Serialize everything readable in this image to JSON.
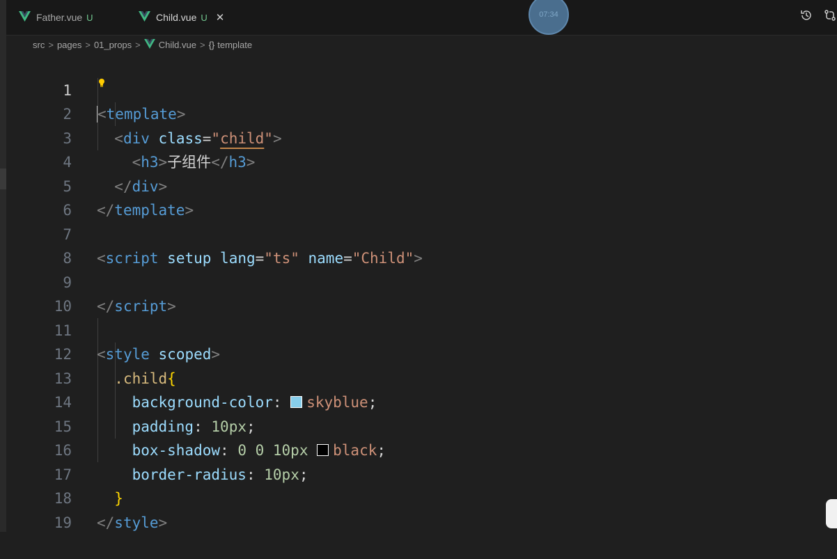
{
  "tabs": [
    {
      "name": "Father.vue",
      "status": "U"
    },
    {
      "name": "Child.vue",
      "status": "U",
      "close": "✕"
    }
  ],
  "overlay_time": "07:34",
  "breadcrumb": [
    "src",
    "pages",
    "01_props",
    "Child.vue",
    "template"
  ],
  "breadcrumb_sep": ">",
  "breadcrumb_braces": "{}",
  "icons": {
    "vue_logo": "vue-logo-icon",
    "history": "history-icon",
    "compare": "compare-changes-icon",
    "lightbulb": "lightbulb-icon"
  },
  "colors": {
    "vue_green": "#41b883",
    "skyblue": "#87ceeb",
    "black": "#000000"
  },
  "code": {
    "line_numbers": [
      "1",
      "2",
      "3",
      "4",
      "5",
      "6",
      "7",
      "8",
      "9",
      "10",
      "11",
      "12",
      "13",
      "14",
      "15",
      "16",
      "17",
      "18",
      "19"
    ],
    "l1": {
      "lt": "<",
      "tag": "template",
      "gt": ">"
    },
    "l2": {
      "lt": "<",
      "tag": "div",
      "attr": "class",
      "eq": "=",
      "q1": "\"",
      "val": "child",
      "q2": "\"",
      "gt": ">"
    },
    "l3": {
      "lt": "<",
      "tag": "h3",
      "gt": ">",
      "text": "子组件",
      "lt2": "</",
      "tag2": "h3",
      "gt2": ">"
    },
    "l4": {
      "lt": "</",
      "tag": "div",
      "gt": ">"
    },
    "l5": {
      "lt": "</",
      "tag": "template",
      "gt": ">"
    },
    "l7": {
      "lt": "<",
      "tag": "script",
      "attr1": "setup",
      "attr2": "lang",
      "eq": "=",
      "val2": "\"ts\"",
      "attr3": "name",
      "val3": "\"Child\"",
      "gt": ">"
    },
    "l9": {
      "lt": "</",
      "tag": "script",
      "gt": ">"
    },
    "l11": {
      "lt": "<",
      "tag": "style",
      "attr": "scoped",
      "gt": ">"
    },
    "l12": {
      "selector": ".child",
      "brace": "{"
    },
    "l13": {
      "prop": "background-color",
      "colon": ":",
      "value": "skyblue",
      "semi": ";"
    },
    "l14": {
      "prop": "padding",
      "colon": ":",
      "value": "10px",
      "semi": ";"
    },
    "l15": {
      "prop": "box-shadow",
      "colon": ":",
      "value_nums": "0 0 10px",
      "value": "black",
      "semi": ";"
    },
    "l16": {
      "prop": "border-radius",
      "colon": ":",
      "value": "10px",
      "semi": ";"
    },
    "l17": {
      "brace": "}"
    },
    "l18": {
      "lt": "</",
      "tag": "style",
      "gt": ">"
    }
  }
}
